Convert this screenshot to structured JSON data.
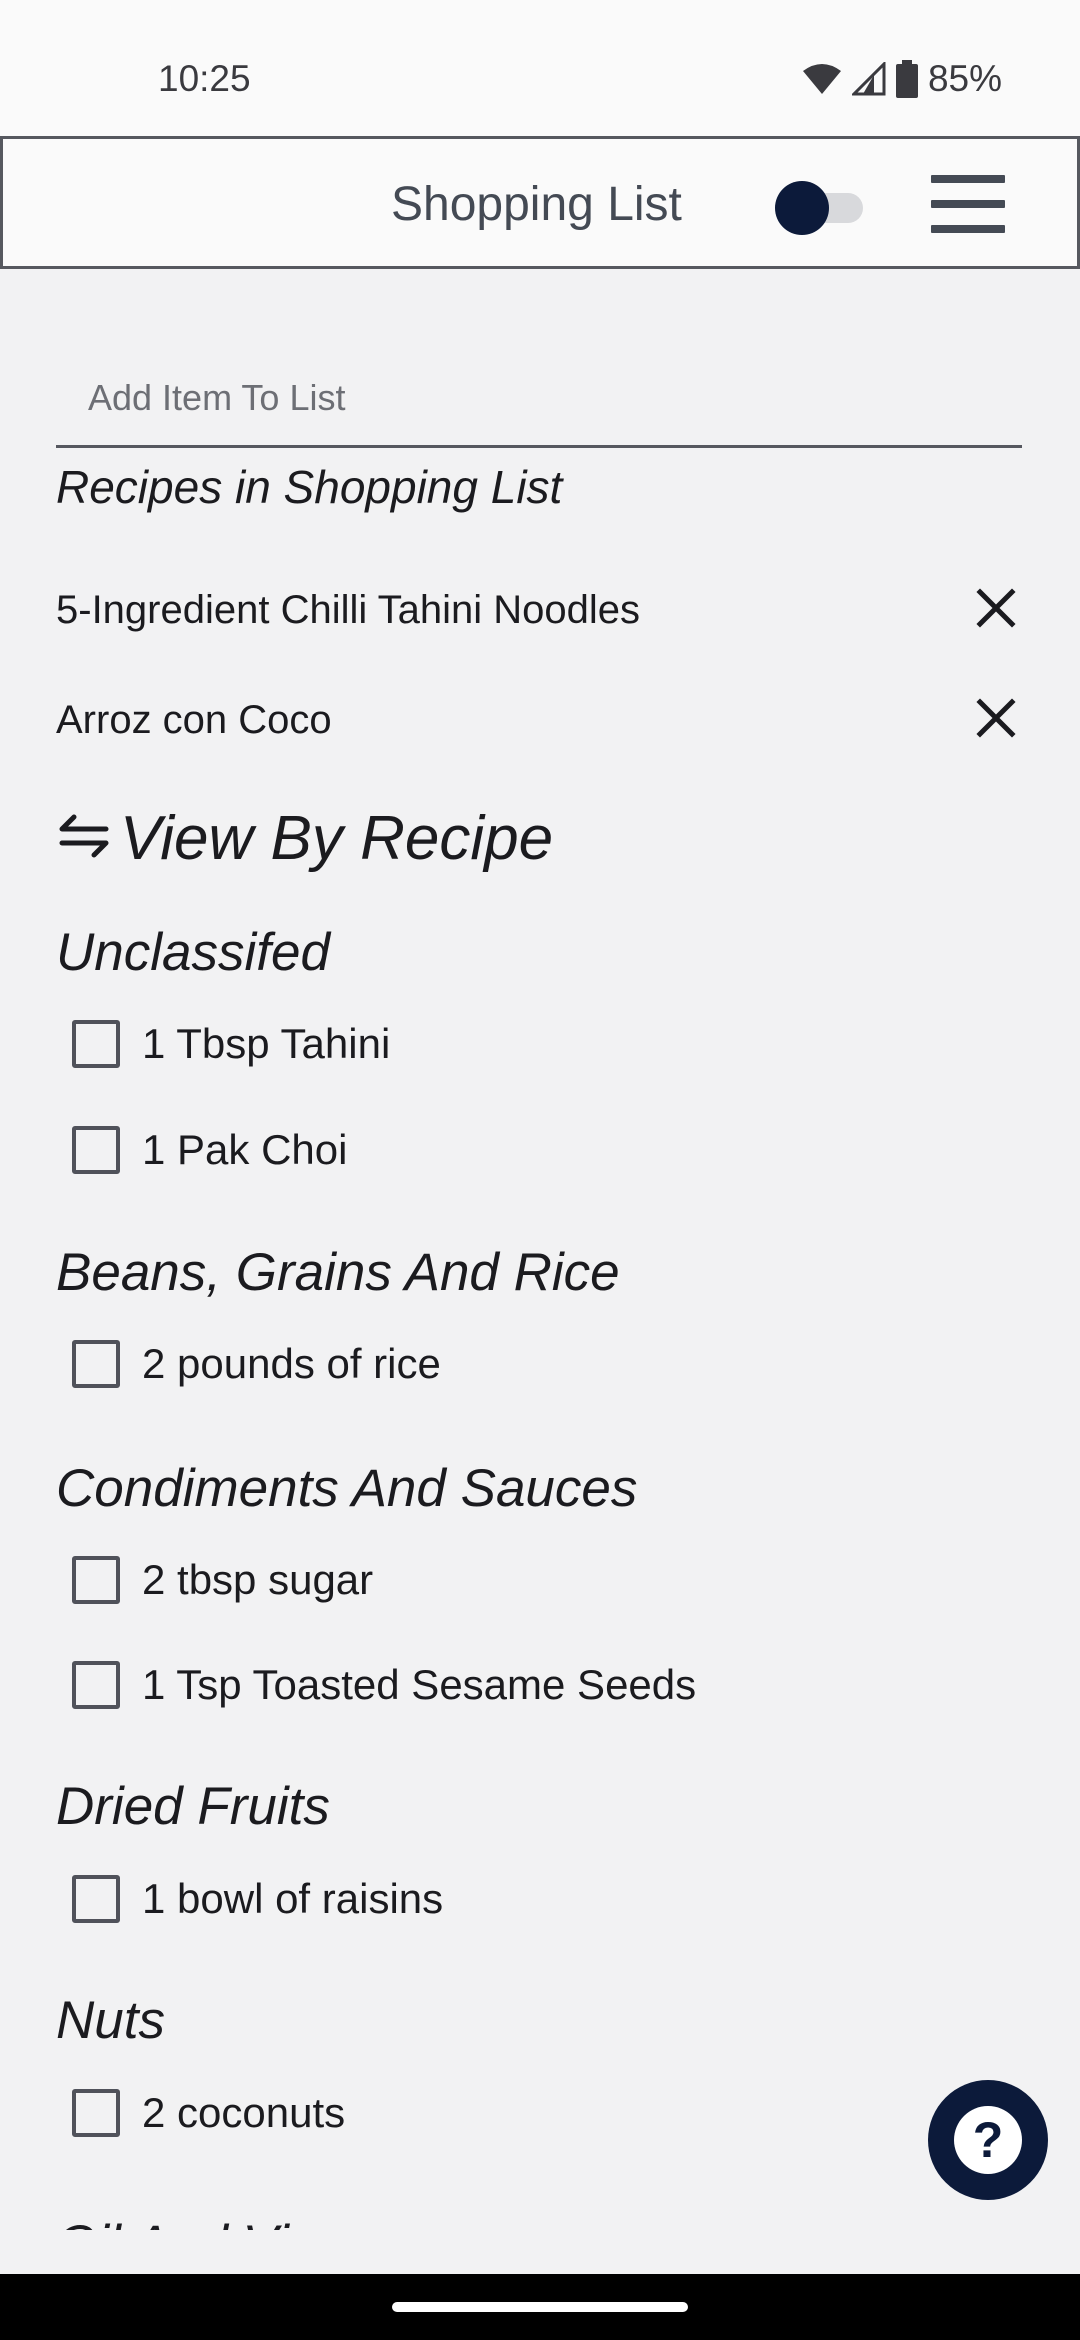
{
  "status_bar": {
    "time": "10:25",
    "battery": "85%"
  },
  "header": {
    "title": "Shopping List"
  },
  "add_item": {
    "placeholder": "Add Item To List"
  },
  "recipes": {
    "heading": "Recipes in Shopping List",
    "items": [
      "5-Ingredient Chilli Tahini Noodles",
      "Arroz con Coco"
    ]
  },
  "view_toggle": {
    "icon": "⇋",
    "label": "View By Recipe"
  },
  "categories": [
    {
      "name": "Unclassifed",
      "items": [
        "1 Tbsp Tahini",
        "1 Pak Choi"
      ]
    },
    {
      "name": "Beans, Grains And Rice",
      "items": [
        "2 pounds of rice"
      ]
    },
    {
      "name": "Condiments And Sauces",
      "items": [
        "2 tbsp sugar",
        "1 Tsp Toasted Sesame Seeds"
      ]
    },
    {
      "name": "Dried Fruits",
      "items": [
        "1 bowl of raisins"
      ]
    },
    {
      "name": "Nuts",
      "items": [
        "2 coconuts"
      ]
    },
    {
      "name": "Oil And Vinegar",
      "items": []
    }
  ],
  "help": {
    "label": "?"
  },
  "colors": {
    "accent": "#0c1a3a",
    "background": "#f2f2f3"
  }
}
